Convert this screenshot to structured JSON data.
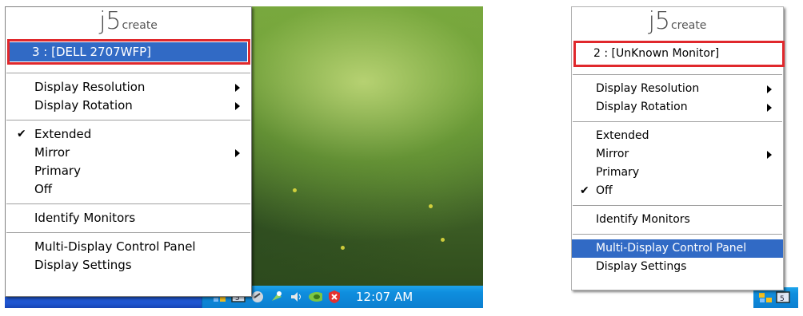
{
  "left": {
    "logo": {
      "big": "j5",
      "small": "create"
    },
    "selected_monitor": "3 : [DELL 2707WFP]",
    "items_group1": [
      {
        "label": "Display Resolution",
        "submenu": true
      },
      {
        "label": "Display Rotation",
        "submenu": true
      }
    ],
    "items_group2": [
      {
        "label": "Extended",
        "checked": true
      },
      {
        "label": "Mirror",
        "submenu": true
      },
      {
        "label": "Primary"
      },
      {
        "label": "Off"
      }
    ],
    "identify": "Identify Monitors",
    "control_panel": "Multi-Display Control Panel",
    "display_settings": "Display Settings",
    "clock": "12:07 AM",
    "tray_icons": [
      "network-icon",
      "j5-monitor-icon",
      "volume-icon",
      "safely-remove-icon",
      "speaker-icon",
      "nvidia-icon",
      "security-icon"
    ]
  },
  "right": {
    "logo": {
      "big": "j5",
      "small": "create"
    },
    "selected_monitor": "2 : [UnKnown Monitor]",
    "items_group1": [
      {
        "label": "Display Resolution",
        "submenu": true
      },
      {
        "label": "Display Rotation",
        "submenu": true
      }
    ],
    "items_group2": [
      {
        "label": "Extended"
      },
      {
        "label": "Mirror",
        "submenu": true
      },
      {
        "label": "Primary"
      },
      {
        "label": "Off",
        "checked": true
      }
    ],
    "identify": "Identify Monitors",
    "control_panel": "Multi-Display Control Panel",
    "display_settings": "Display Settings",
    "tray_icons": [
      "network-icon",
      "j5-monitor-icon"
    ]
  },
  "colors": {
    "highlight": "#316ac5",
    "callout": "#e0282c",
    "taskbar": "#245edb",
    "tray": "#0f8ede"
  }
}
